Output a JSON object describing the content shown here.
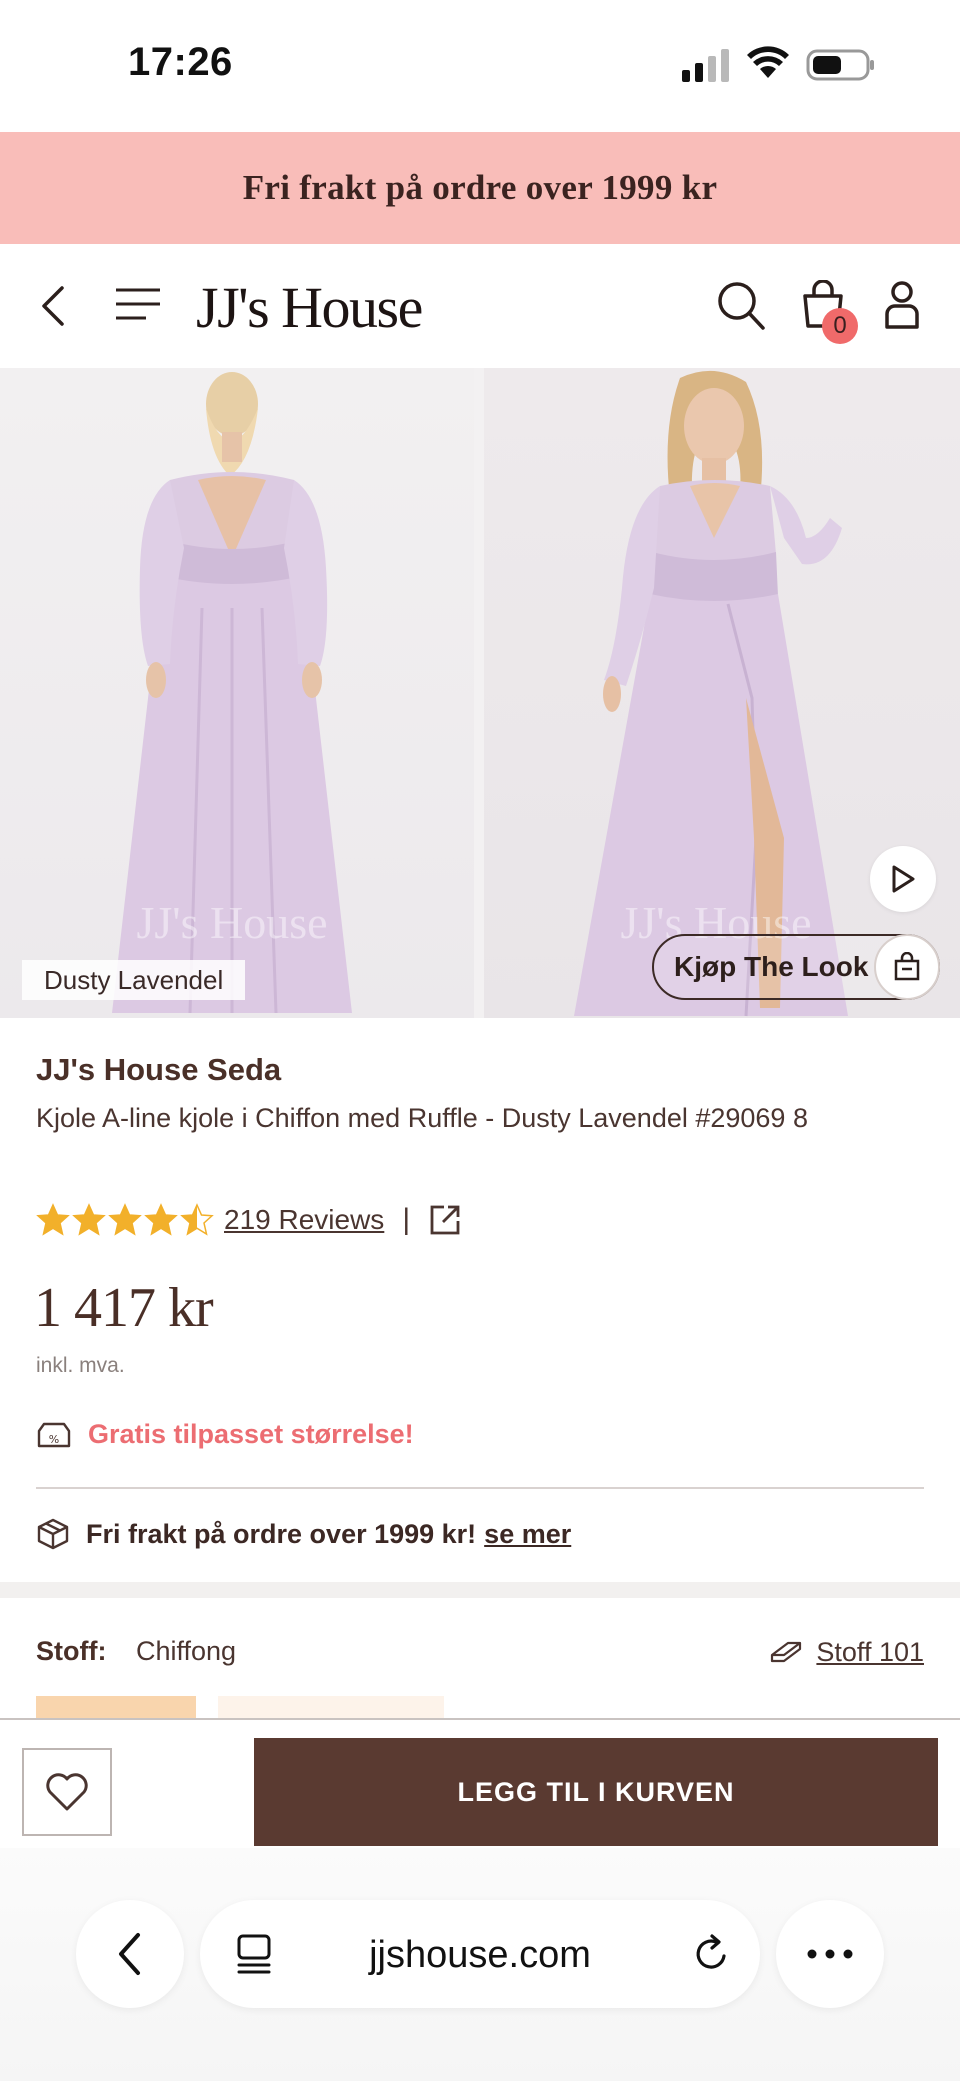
{
  "status_bar": {
    "time": "17:26"
  },
  "promo_banner": {
    "text": "Fri frakt på ordre over 1999 kr"
  },
  "header": {
    "logo": "JJ's House",
    "cart_count": "0"
  },
  "gallery": {
    "color_tag": "Dusty Lavendel",
    "watermark": "JJ's House",
    "shop_the_look": "Kjøp The Look"
  },
  "product": {
    "brand_title": "JJ's House Seda",
    "name": "Kjole A-line kjole i Chiffon med Ruffle - Dusty Lavendel #29069 8",
    "rating": 4.5,
    "reviews": "219 Reviews",
    "separator": "|",
    "price": "1 417 kr",
    "vat_note": "inkl. mva.",
    "perk_size": "Gratis tilpasset størrelse!",
    "perk_shipping": "Fri frakt på ordre over 1999 kr!",
    "perk_shipping_link": "se mer"
  },
  "fabric": {
    "label": "Stoff:",
    "value": "Chiffong",
    "guide_link": "Stoff 101"
  },
  "action_bar": {
    "add_to_cart": "LEGG TIL I KURVEN"
  },
  "browser": {
    "url": "jjshouse.com"
  },
  "colors": {
    "promo_bg": "#f9bdb9",
    "accent_red": "#ec6d72",
    "button_brown": "#5a3a31",
    "star_gold": "#f2b02a"
  }
}
